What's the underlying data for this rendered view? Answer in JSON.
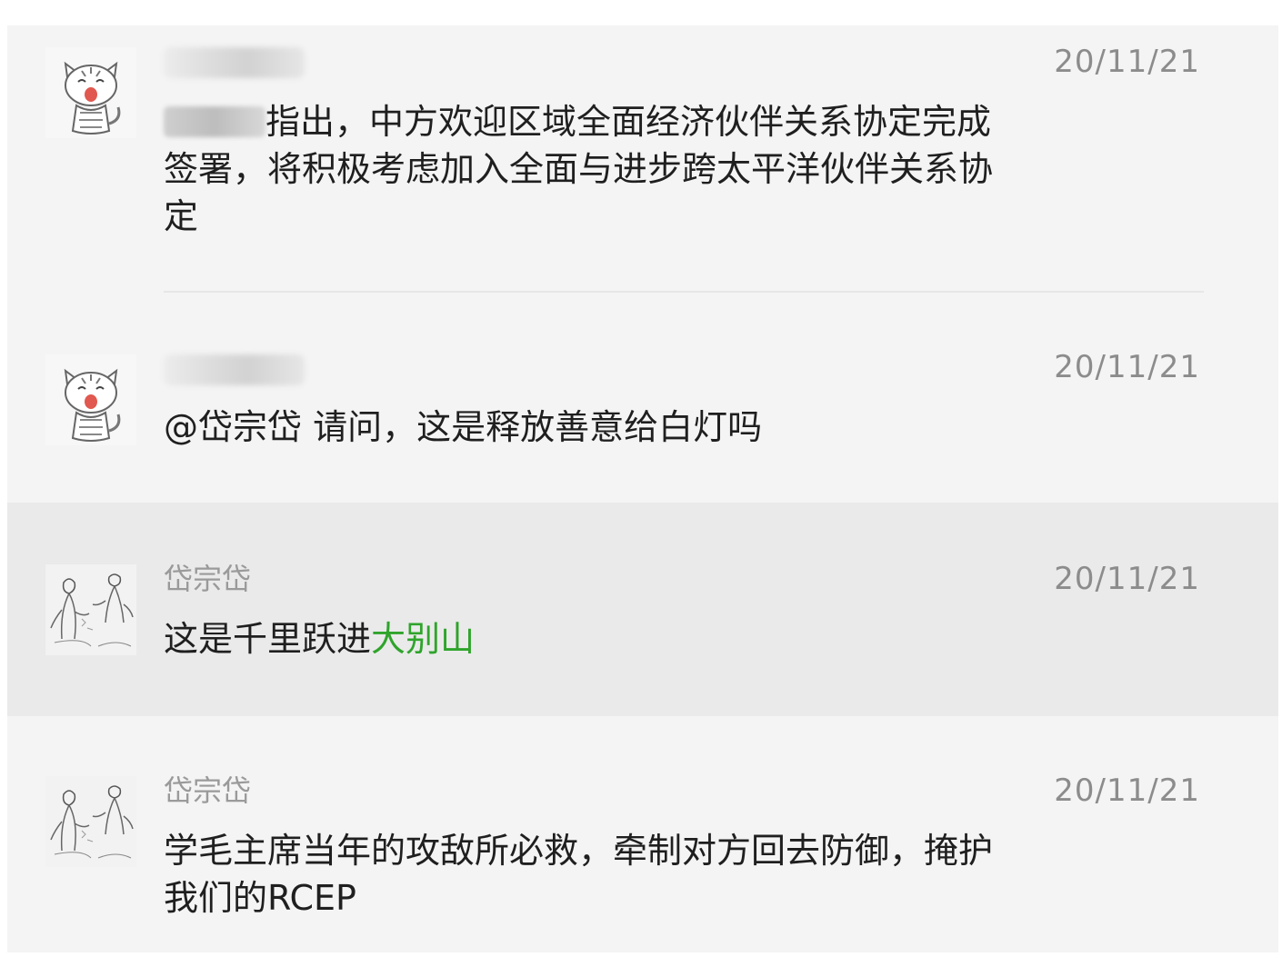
{
  "messages": [
    {
      "author": "",
      "author_hidden": true,
      "avatar": "cartoon-cat-avatar",
      "date": "20/11/21",
      "text_prefix": "习近平",
      "text": "指出，中方欢迎区域全面经济伙伴关系协定完成签署，将积极考虑加入全面与进步跨太平洋伙伴关系协定",
      "highlighted": false
    },
    {
      "author": "",
      "author_hidden": true,
      "avatar": "cartoon-cat-avatar",
      "date": "20/11/21",
      "text": "@岱宗岱 请问，这是释放善意给白灯吗",
      "highlighted": false
    },
    {
      "author": "岱宗岱",
      "avatar": "ink-sketch-figures-avatar",
      "date": "20/11/21",
      "text": "这是千里跃进",
      "link_text": "大别山",
      "highlighted": true
    },
    {
      "author": "岱宗岱",
      "avatar": "ink-sketch-figures-avatar",
      "date": "20/11/21",
      "text": "学毛主席当年的攻敌所必救，牵制对方回去防御，掩护我们的RCEP",
      "highlighted": false
    }
  ],
  "colors": {
    "panel_bg": "#f4f4f4",
    "highlight_bg": "#eaeaea",
    "link": "#2fa42b",
    "date": "#8c8c8c",
    "author": "#9a9a9a",
    "text": "#1f1f1f"
  }
}
